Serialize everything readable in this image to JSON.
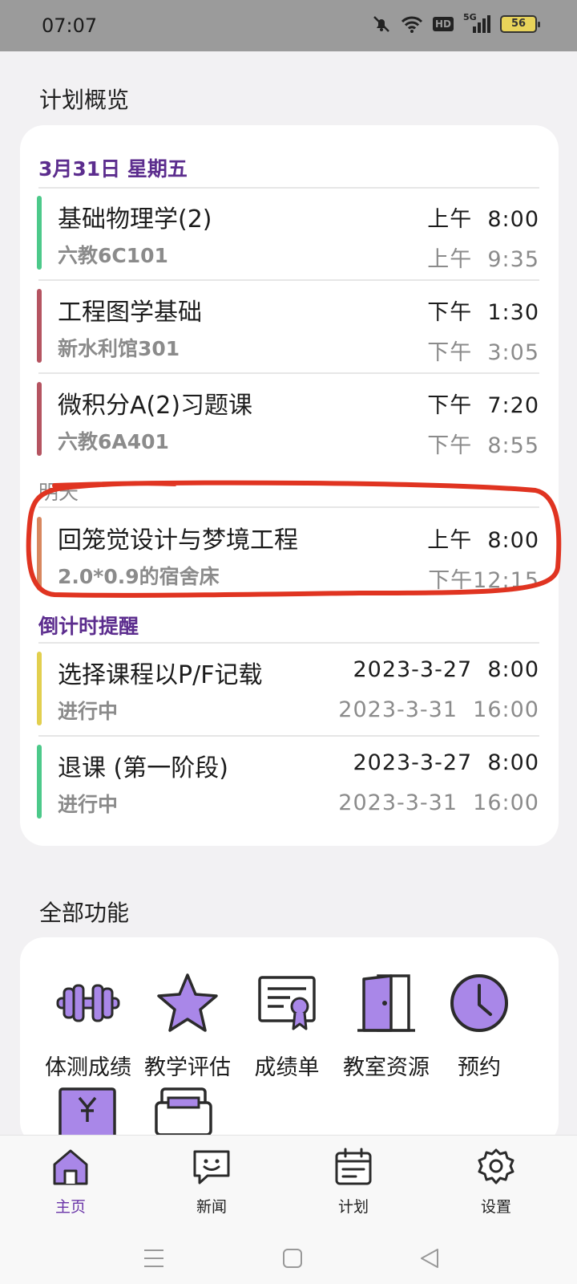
{
  "status_bar": {
    "time": "07:07",
    "hd": "HD",
    "network": "5G",
    "battery": "56"
  },
  "overview": {
    "title": "计划概览",
    "today_label": "3月31日 星期五",
    "today_events": [
      {
        "title": "基础物理学(2)",
        "location": "六教6C101",
        "start": "上午  8:00",
        "end": "上午  9:35",
        "color": "#4cc98a"
      },
      {
        "title": "工程图学基础",
        "location": "新水利馆301",
        "start": "下午  1:30",
        "end": "下午  3:05",
        "color": "#b55461"
      },
      {
        "title": "微积分A(2)习题课",
        "location": "六教6A401",
        "start": "下午  7:20",
        "end": "下午  8:55",
        "color": "#b55461"
      }
    ],
    "tomorrow_label": "明天",
    "tomorrow_events": [
      {
        "title": "回笼觉设计与梦境工程",
        "location": "2.0*0.9的宿舍床",
        "start": "上午  8:00",
        "end": "下午12:15",
        "color": "#d8875f"
      }
    ],
    "countdown_label": "倒计时提醒",
    "countdown_events": [
      {
        "title": "选择课程以P/F记载",
        "status": "进行中",
        "start": "2023-3-27  8:00",
        "end": "2023-3-31  16:00",
        "color": "#e2cf4e"
      },
      {
        "title": "退课 (第一阶段)",
        "status": "进行中",
        "start": "2023-3-27  8:00",
        "end": "2023-3-31  16:00",
        "color": "#4cc98a"
      }
    ]
  },
  "features": {
    "title": "全部功能",
    "items": [
      {
        "label": "体测成绩",
        "icon": "dumbbell-icon"
      },
      {
        "label": "教学评估",
        "icon": "star-icon"
      },
      {
        "label": "成绩单",
        "icon": "certificate-icon"
      },
      {
        "label": "教室资源",
        "icon": "door-icon"
      },
      {
        "label": "预约",
        "icon": "clock-icon"
      }
    ]
  },
  "bottom_nav": [
    {
      "label": "主页",
      "icon": "home-icon"
    },
    {
      "label": "新闻",
      "icon": "chat-icon"
    },
    {
      "label": "计划",
      "icon": "calendar-icon"
    },
    {
      "label": "设置",
      "icon": "gear-icon"
    }
  ],
  "colors": {
    "accent": "#6a35a8",
    "icon_fill": "#a987e8",
    "annotation": "#e03421"
  }
}
